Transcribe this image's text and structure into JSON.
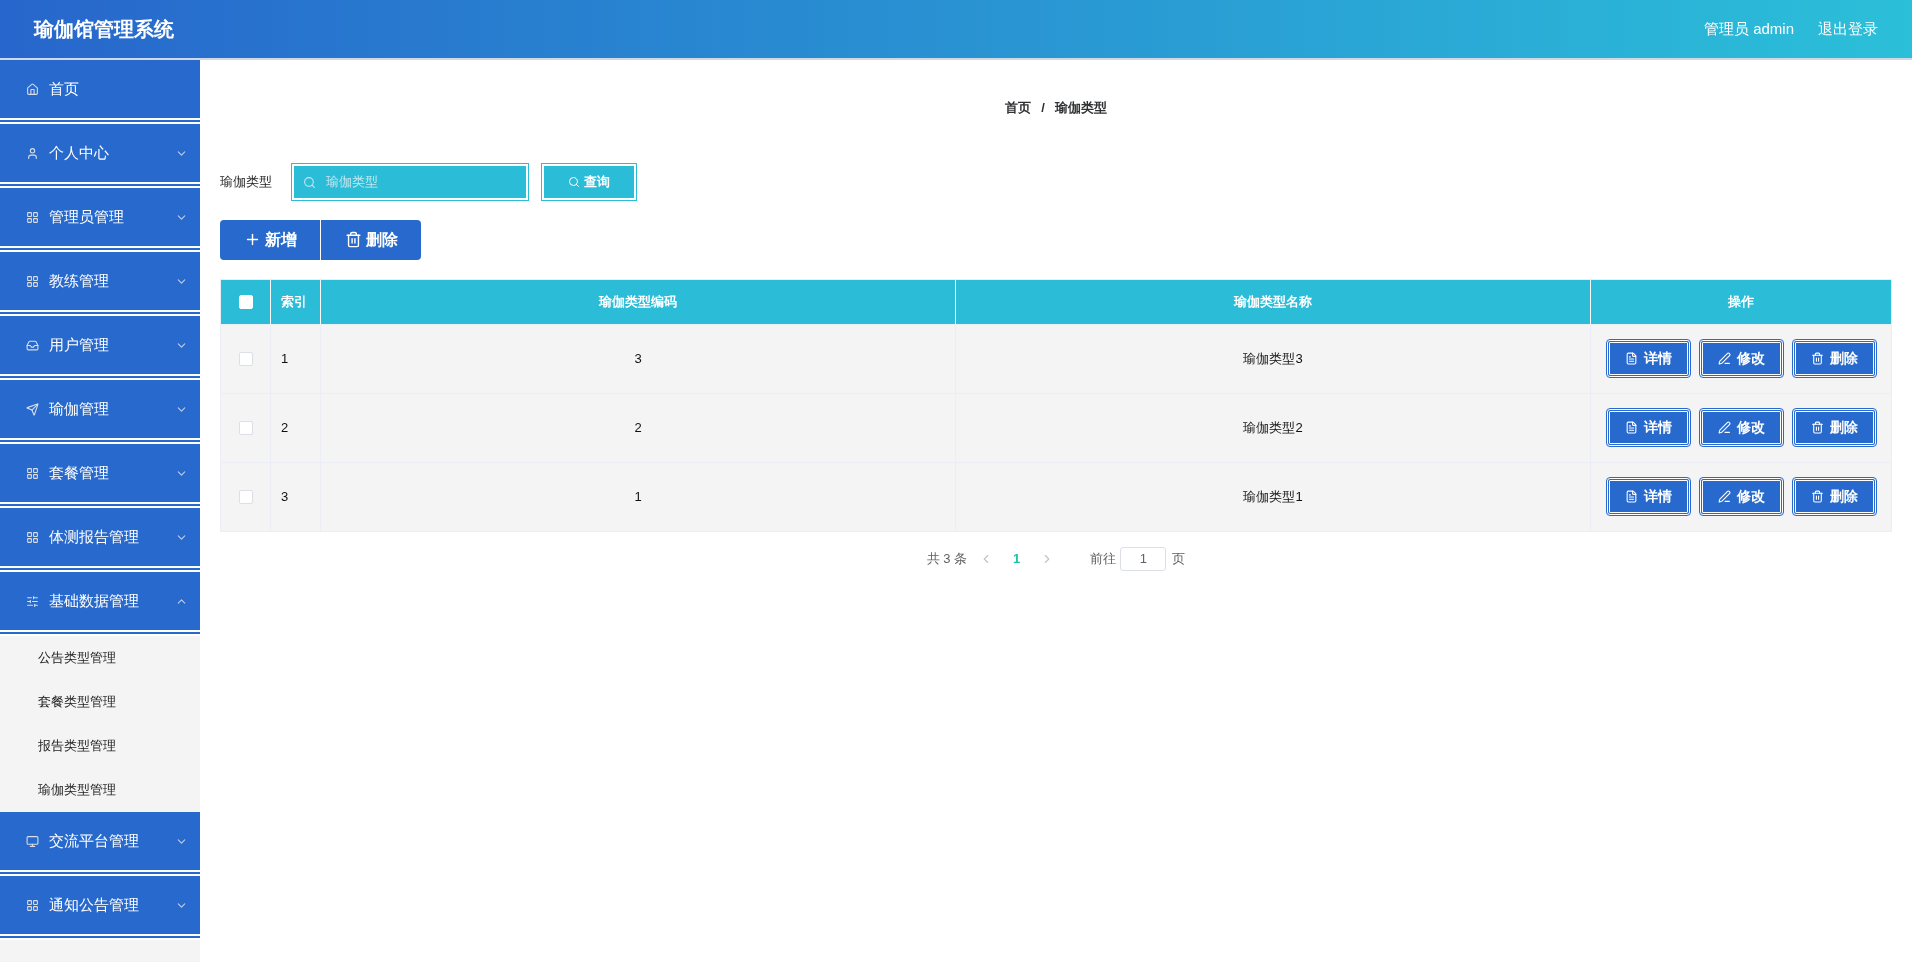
{
  "header": {
    "title": "瑜伽馆管理系统",
    "user": "管理员 admin",
    "logout": "退出登录"
  },
  "sidebar": {
    "items": [
      {
        "label": "首页"
      },
      {
        "label": "个人中心",
        "expanded": false
      },
      {
        "label": "管理员管理",
        "expanded": false
      },
      {
        "label": "教练管理",
        "expanded": false
      },
      {
        "label": "用户管理",
        "expanded": false
      },
      {
        "label": "瑜伽管理",
        "expanded": false
      },
      {
        "label": "套餐管理",
        "expanded": false
      },
      {
        "label": "体测报告管理",
        "expanded": false
      },
      {
        "label": "基础数据管理",
        "expanded": true,
        "children": [
          {
            "label": "公告类型管理"
          },
          {
            "label": "套餐类型管理"
          },
          {
            "label": "报告类型管理"
          },
          {
            "label": "瑜伽类型管理"
          }
        ]
      },
      {
        "label": "交流平台管理",
        "expanded": false
      },
      {
        "label": "通知公告管理",
        "expanded": false
      }
    ]
  },
  "breadcrumb": [
    "首页",
    "/",
    "瑜伽类型"
  ],
  "search": {
    "label": "瑜伽类型",
    "placeholder": "瑜伽类型",
    "button": "查询"
  },
  "actions": [
    "新增",
    "删除"
  ],
  "table": {
    "select_all_checked": false,
    "columns": [
      "索引",
      "瑜伽类型编码",
      "瑜伽类型名称",
      "操作"
    ],
    "rows": [
      {
        "checked": false,
        "cells": [
          "1",
          "3",
          "瑜伽类型3"
        ],
        "buttons": [
          "详情",
          "修改",
          "删除"
        ]
      },
      {
        "checked": false,
        "cells": [
          "2",
          "2",
          "瑜伽类型2"
        ],
        "buttons": [
          "详情",
          "修改",
          "删除"
        ]
      },
      {
        "checked": false,
        "cells": [
          "3",
          "1",
          "瑜伽类型1"
        ],
        "buttons": [
          "详情",
          "修改",
          "删除"
        ]
      }
    ]
  },
  "pagination": {
    "total": "共 3 条",
    "pages": [
      {
        "label": "1",
        "selected": true
      }
    ],
    "goto": "前往",
    "page_value": "1",
    "page_suffix": "页"
  }
}
